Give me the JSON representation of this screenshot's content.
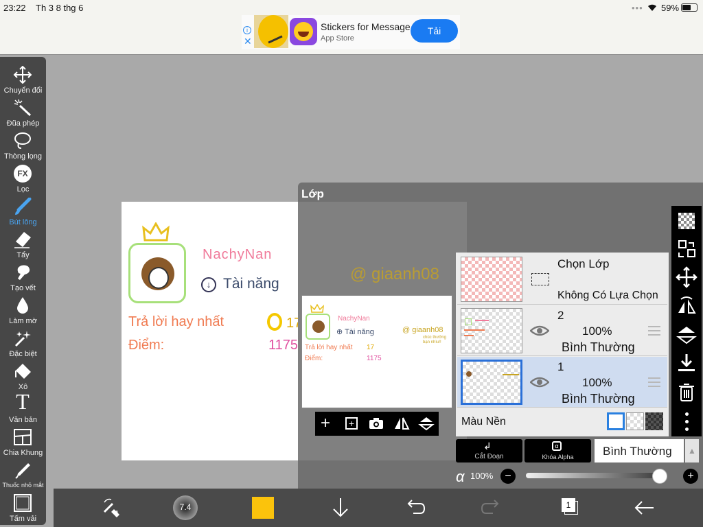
{
  "status": {
    "time": "23:22",
    "date": "Th 3 8 thg 6",
    "battery": "59%"
  },
  "ad": {
    "title": "Stickers for Message",
    "subtitle": "App Store",
    "button": "Tải",
    "info_icon": "info-icon",
    "close_icon": "close-icon"
  },
  "toolbar": [
    {
      "label": "Chuyển đổi",
      "icon": "move-icon"
    },
    {
      "label": "Đũa phép",
      "icon": "magic-wand-icon"
    },
    {
      "label": "Thòng lọng",
      "icon": "lasso-icon"
    },
    {
      "label": "Lọc",
      "icon": "fx-filter-icon",
      "glyph": "FX"
    },
    {
      "label": "Bút lông",
      "icon": "brush-icon",
      "active": true
    },
    {
      "label": "Tẩy",
      "icon": "eraser-icon"
    },
    {
      "label": "Tạo vết",
      "icon": "smudge-icon"
    },
    {
      "label": "Làm mờ",
      "icon": "blur-icon"
    },
    {
      "label": "Đặc biệt",
      "icon": "special-icon"
    },
    {
      "label": "Xô",
      "icon": "bucket-icon"
    },
    {
      "label": "Văn bản",
      "icon": "text-icon",
      "glyph": "T"
    },
    {
      "label": "Chia Khung",
      "icon": "frame-divider-icon"
    },
    {
      "label": "Thuốc nhỏ mắt",
      "icon": "eyedropper-icon"
    },
    {
      "label": "Tấm vải",
      "icon": "canvas-icon"
    }
  ],
  "artwork": {
    "name": "NachyNan",
    "badge": "Tài năng",
    "best_answer": "Trả lời hay nhất",
    "points_label": "Điểm:",
    "medal_count": "17",
    "points": "1175",
    "watermark": "@ giaanh08",
    "note": "chúc thưởng bạn nhìu!!"
  },
  "panel": {
    "title": "Lớp",
    "select_layer": {
      "title": "Chọn Lớp",
      "subtitle": "Không Có Lựa Chọn"
    },
    "layers": [
      {
        "name": "2",
        "opacity": "100%",
        "mode": "Bình Thường",
        "selected": false
      },
      {
        "name": "1",
        "opacity": "100%",
        "mode": "Bình Thường",
        "selected": true
      }
    ],
    "background_label": "Màu Nền",
    "clip_label": "Cắt Đoạn",
    "alpha_lock_label": "Khóa Alpha",
    "blend_mode": "Bình Thường",
    "alpha_symbol": "α",
    "alpha_value": "100%",
    "alpha_level": 1.0
  },
  "bottombar": {
    "brush_size": "7.4",
    "color": "#fbc30c",
    "layer_count": "1"
  },
  "colors": {
    "accent": "#4aa4f0",
    "selected_layer": "#cfdcf0",
    "ad_button": "#1a7bf2"
  }
}
